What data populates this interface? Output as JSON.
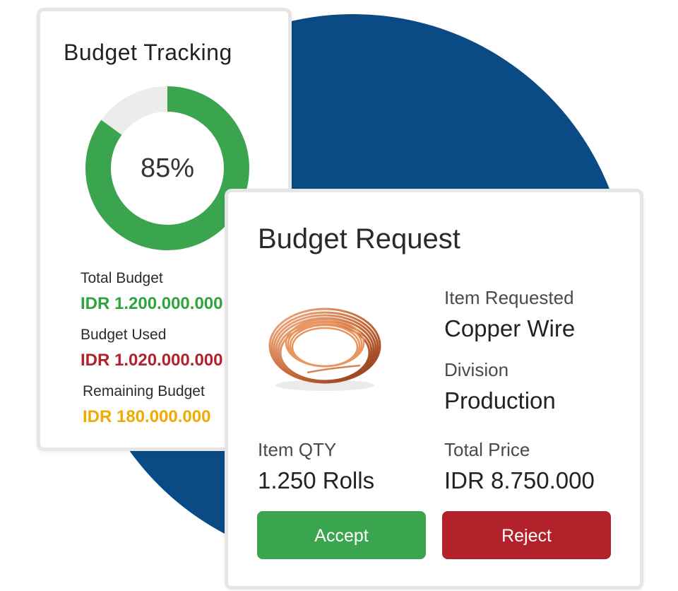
{
  "tracking": {
    "title": "Budget Tracking",
    "progress_percent": 85,
    "progress_label": "85%",
    "total_label": "Total Budget",
    "total_value": "IDR 1.200.000.000",
    "used_label": "Budget Used",
    "used_value": "IDR 1.020.000.000",
    "remaining_label": "Remaining Budget",
    "remaining_value": "IDR 180.000.000",
    "colors": {
      "progress": "#3aa54e",
      "track": "#ececec",
      "total": "#2ea43c",
      "used": "#b3212b",
      "remaining": "#f2a900"
    }
  },
  "request": {
    "title": "Budget Request",
    "item_image_icon": "copper-wire-coil",
    "item_label": "Item Requested",
    "item_value": "Copper Wire",
    "division_label": "Division",
    "division_value": "Production",
    "qty_label": "Item QTY",
    "qty_value": "1.250 Rolls",
    "price_label": "Total Price",
    "price_value": "IDR 8.750.000",
    "accept_label": "Accept",
    "reject_label": "Reject",
    "colors": {
      "accept": "#3aa54e",
      "reject": "#b3212b"
    }
  },
  "background": {
    "accent": "#0a4b85"
  }
}
